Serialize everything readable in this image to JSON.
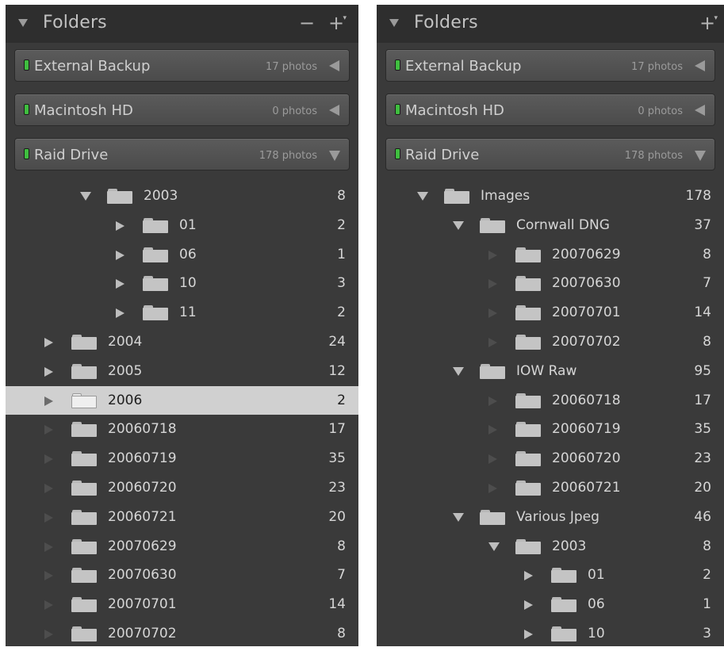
{
  "left_panel": {
    "title": "Folders",
    "minus_label": "−",
    "plus_label": "+",
    "plus_caret": "▾",
    "volumes": [
      {
        "name": "External Backup",
        "count": "17 photos",
        "expanded": false
      },
      {
        "name": "Macintosh HD",
        "count": "0 photos",
        "expanded": false
      },
      {
        "name": "Raid Drive",
        "count": "178 photos",
        "expanded": true
      }
    ],
    "rows": [
      {
        "level": 1,
        "toggle": "down",
        "name": "2003",
        "count": "8"
      },
      {
        "level": 2,
        "toggle": "right",
        "name": "01",
        "count": "2"
      },
      {
        "level": 2,
        "toggle": "right",
        "name": "06",
        "count": "1"
      },
      {
        "level": 2,
        "toggle": "right",
        "name": "10",
        "count": "3"
      },
      {
        "level": 2,
        "toggle": "right",
        "name": "11",
        "count": "2"
      },
      {
        "level": 0,
        "toggle": "right",
        "name": "2004",
        "count": "24"
      },
      {
        "level": 0,
        "toggle": "right",
        "name": "2005",
        "count": "12"
      },
      {
        "level": 0,
        "toggle": "right",
        "name": "2006",
        "count": "2",
        "selected": true
      },
      {
        "level": 0,
        "toggle": "none",
        "name": "20060718",
        "count": "17"
      },
      {
        "level": 0,
        "toggle": "none",
        "name": "20060719",
        "count": "35"
      },
      {
        "level": 0,
        "toggle": "none",
        "name": "20060720",
        "count": "23"
      },
      {
        "level": 0,
        "toggle": "none",
        "name": "20060721",
        "count": "20"
      },
      {
        "level": 0,
        "toggle": "none",
        "name": "20070629",
        "count": "8"
      },
      {
        "level": 0,
        "toggle": "none",
        "name": "20070630",
        "count": "7"
      },
      {
        "level": 0,
        "toggle": "none",
        "name": "20070701",
        "count": "14"
      },
      {
        "level": 0,
        "toggle": "none",
        "name": "20070702",
        "count": "8"
      }
    ]
  },
  "right_panel": {
    "title": "Folders",
    "plus_label": "+",
    "plus_caret": "▾",
    "volumes": [
      {
        "name": "External Backup",
        "count": "17 photos",
        "expanded": false
      },
      {
        "name": "Macintosh HD",
        "count": "0 photos",
        "expanded": false
      },
      {
        "name": "Raid Drive",
        "count": "178 photos",
        "expanded": true
      }
    ],
    "rows": [
      {
        "level": 0,
        "toggle": "down",
        "name": "Images",
        "count": "178"
      },
      {
        "level": 1,
        "toggle": "down",
        "name": "Cornwall DNG",
        "count": "37"
      },
      {
        "level": 2,
        "toggle": "none",
        "name": "20070629",
        "count": "8"
      },
      {
        "level": 2,
        "toggle": "none",
        "name": "20070630",
        "count": "7"
      },
      {
        "level": 2,
        "toggle": "none",
        "name": "20070701",
        "count": "14"
      },
      {
        "level": 2,
        "toggle": "none",
        "name": "20070702",
        "count": "8"
      },
      {
        "level": 1,
        "toggle": "down",
        "name": "IOW Raw",
        "count": "95"
      },
      {
        "level": 2,
        "toggle": "none",
        "name": "20060718",
        "count": "17"
      },
      {
        "level": 2,
        "toggle": "none",
        "name": "20060719",
        "count": "35"
      },
      {
        "level": 2,
        "toggle": "none",
        "name": "20060720",
        "count": "23"
      },
      {
        "level": 2,
        "toggle": "none",
        "name": "20060721",
        "count": "20"
      },
      {
        "level": 1,
        "toggle": "down",
        "name": "Various Jpeg",
        "count": "46"
      },
      {
        "level": 2,
        "toggle": "down",
        "name": "2003",
        "count": "8"
      },
      {
        "level": 3,
        "toggle": "right",
        "name": "01",
        "count": "2"
      },
      {
        "level": 3,
        "toggle": "right",
        "name": "06",
        "count": "1"
      },
      {
        "level": 3,
        "toggle": "right",
        "name": "10",
        "count": "3"
      }
    ]
  }
}
